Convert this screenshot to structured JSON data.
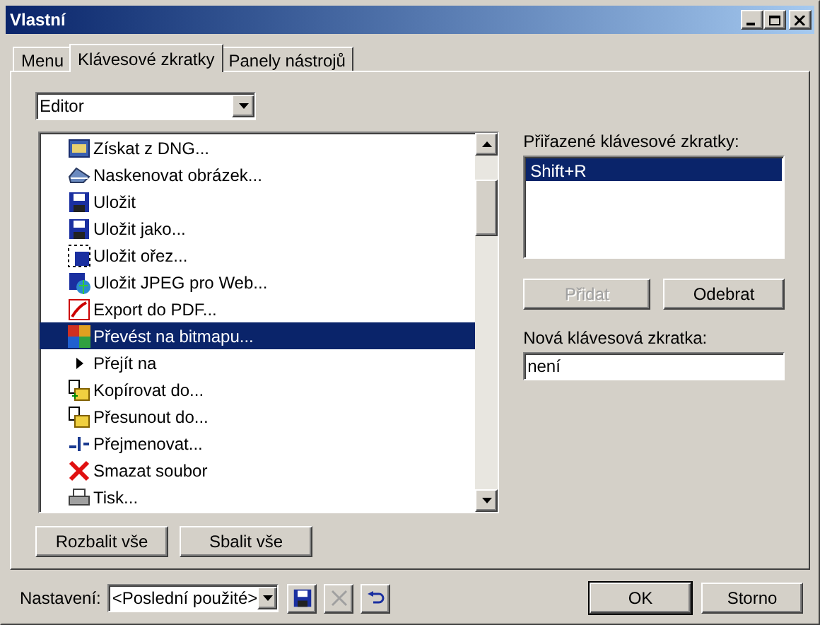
{
  "window": {
    "title": "Vlastní"
  },
  "tabs": [
    {
      "label": "Menu",
      "selected": false
    },
    {
      "label": "Klávesové zkratky",
      "selected": true
    },
    {
      "label": "Panely nástrojů",
      "selected": false
    }
  ],
  "category": {
    "value": "Editor"
  },
  "commands": [
    {
      "label": "Získat z DNG...",
      "kind": "command",
      "selected": false
    },
    {
      "label": "Naskenovat obrázek...",
      "kind": "command",
      "selected": false
    },
    {
      "label": "Uložit",
      "kind": "command",
      "selected": false
    },
    {
      "label": "Uložit jako...",
      "kind": "command",
      "selected": false
    },
    {
      "label": "Uložit ořez...",
      "kind": "command",
      "selected": false
    },
    {
      "label": "Uložit JPEG pro Web...",
      "kind": "command",
      "selected": false
    },
    {
      "label": "Export do PDF...",
      "kind": "command",
      "selected": false
    },
    {
      "label": "Převést na bitmapu...",
      "kind": "command",
      "selected": true
    },
    {
      "label": "Přejít na",
      "kind": "group",
      "expanded": false,
      "selected": false
    },
    {
      "label": "Kopírovat do...",
      "kind": "command",
      "selected": false
    },
    {
      "label": "Přesunout do...",
      "kind": "command",
      "selected": false
    },
    {
      "label": "Přejmenovat...",
      "kind": "command",
      "selected": false
    },
    {
      "label": "Smazat soubor",
      "kind": "command",
      "selected": false
    },
    {
      "label": "Tisk...",
      "kind": "command",
      "selected": false
    }
  ],
  "assigned": {
    "label": "Přiřazené klávesové zkratky:",
    "items": [
      {
        "label": "Shift+R",
        "selected": true
      }
    ]
  },
  "add_button": {
    "label": "Přidat",
    "disabled": true
  },
  "remove_button": {
    "label": "Odebrat",
    "disabled": false
  },
  "new_shortcut": {
    "label": "Nová klávesová zkratka:",
    "value": "není"
  },
  "expand_all": "Rozbalit vše",
  "collapse_all": "Sbalit vše",
  "preset": {
    "label": "Nastavení:",
    "value": "<Poslední použité>",
    "delete_disabled": true
  },
  "ok": "OK",
  "cancel": "Storno"
}
